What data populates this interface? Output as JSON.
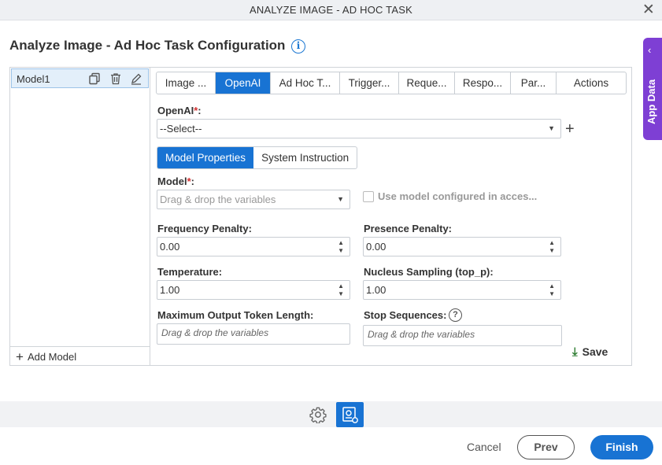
{
  "window": {
    "title": "ANALYZE IMAGE - AD HOC TASK",
    "close_glyph": "✕"
  },
  "page": {
    "title": "Analyze Image - Ad Hoc Task Configuration",
    "info_glyph": "i"
  },
  "side_panel": {
    "label": "App Data",
    "chevron": "‹"
  },
  "models": {
    "items": [
      {
        "name": "Model1"
      }
    ],
    "add_label": "Add Model"
  },
  "tabs": [
    {
      "label": "Image ...",
      "active": false
    },
    {
      "label": "OpenAI",
      "active": true
    },
    {
      "label": "Ad Hoc T...",
      "active": false
    },
    {
      "label": "Trigger...",
      "active": false
    },
    {
      "label": "Reque...",
      "active": false
    },
    {
      "label": "Respo...",
      "active": false
    },
    {
      "label": "Par...",
      "active": false
    },
    {
      "label": "Actions",
      "active": false
    }
  ],
  "openai": {
    "label": "OpenAI",
    "required_mark": "*",
    "suffix": ":",
    "value": "--Select--"
  },
  "subtabs": [
    {
      "label": "Model Properties",
      "active": true
    },
    {
      "label": "System Instruction",
      "active": false
    }
  ],
  "model_field": {
    "label": "Model",
    "required_mark": "*",
    "suffix": ":",
    "placeholder": "Drag & drop the variables"
  },
  "use_model_checkbox": {
    "label": "Use model configured in acces...",
    "checked": false
  },
  "frequency_penalty": {
    "label": "Frequency Penalty:",
    "value": "0.00"
  },
  "presence_penalty": {
    "label": "Presence Penalty:",
    "value": "0.00"
  },
  "temperature": {
    "label": "Temperature:",
    "value": "1.00"
  },
  "nucleus_sampling": {
    "label": "Nucleus Sampling (top_p):",
    "value": "1.00"
  },
  "max_tokens": {
    "label": "Maximum Output Token Length:",
    "placeholder": "Drag & drop the variables"
  },
  "stop_sequences": {
    "label": "Stop Sequences:",
    "placeholder": "Drag & drop the variables",
    "help_glyph": "?"
  },
  "save": {
    "label": "Save"
  },
  "footer": {
    "cancel": "Cancel",
    "prev": "Prev",
    "finish": "Finish"
  },
  "colors": {
    "primary": "#1873d3",
    "app_data": "#7e3fd4",
    "required": "#d32f2f",
    "save_icon": "#2e7d32"
  }
}
